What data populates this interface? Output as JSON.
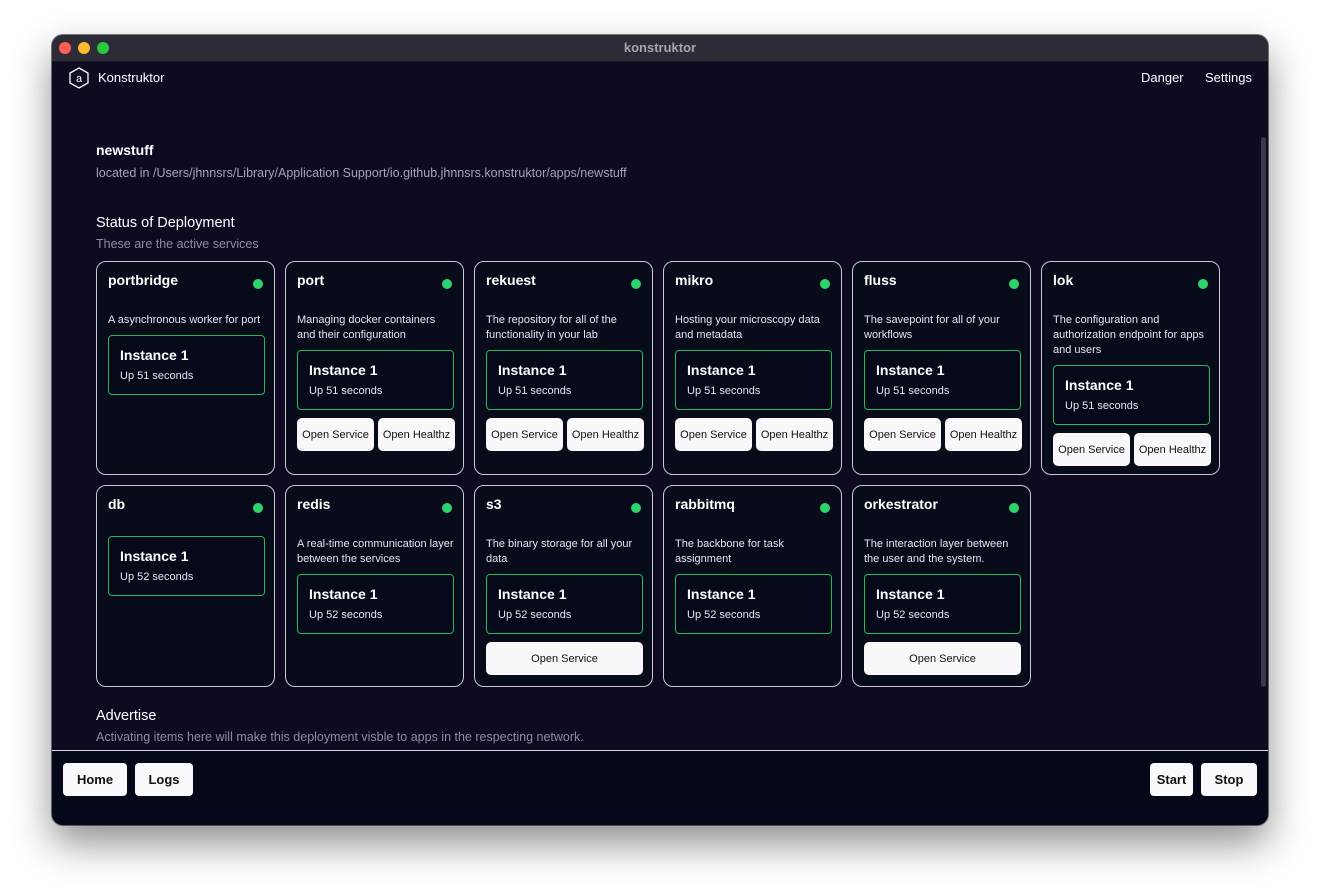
{
  "window": {
    "title": "konstruktor"
  },
  "navbar": {
    "brand": "Konstruktor",
    "logo_letter": "a",
    "danger": "Danger",
    "settings": "Settings"
  },
  "app": {
    "name": "newstuff",
    "path": "located in /Users/jhnnsrs/Library/Application Support/io.github.jhnnsrs.konstruktor/apps/newstuff"
  },
  "deployment": {
    "title": "Status of Deployment",
    "subtitle": "These are the active services"
  },
  "services": [
    {
      "name": "portbridge",
      "description": "A asynchronous worker for port",
      "instance": "Instance 1",
      "uptime": "Up 51 seconds"
    },
    {
      "name": "port",
      "description": "Managing docker containers and their configuration",
      "instance": "Instance 1",
      "uptime": "Up 51 seconds",
      "open_service": "Open Service",
      "open_healthz": "Open Healthz"
    },
    {
      "name": "rekuest",
      "description": "The repository for all of the functionality in your lab",
      "instance": "Instance 1",
      "uptime": "Up 51 seconds",
      "open_service": "Open Service",
      "open_healthz": "Open Healthz"
    },
    {
      "name": "mikro",
      "description": "Hosting your microscopy data and metadata",
      "instance": "Instance 1",
      "uptime": "Up 51 seconds",
      "open_service": "Open Service",
      "open_healthz": "Open Healthz"
    },
    {
      "name": "fluss",
      "description": "The savepoint for all of your workflows",
      "instance": "Instance 1",
      "uptime": "Up 51 seconds",
      "open_service": "Open Service",
      "open_healthz": "Open Healthz"
    },
    {
      "name": "lok",
      "description": "The configuration and authorization endpoint for apps and users",
      "instance": "Instance 1",
      "uptime": "Up 51 seconds",
      "open_service": "Open Service",
      "open_healthz": "Open Healthz"
    },
    {
      "name": "db",
      "description": "",
      "instance": "Instance 1",
      "uptime": "Up 52 seconds"
    },
    {
      "name": "redis",
      "description": "A real-time communication layer between the services",
      "instance": "Instance 1",
      "uptime": "Up 52 seconds"
    },
    {
      "name": "s3",
      "description": "The binary storage for all your data",
      "instance": "Instance 1",
      "uptime": "Up 52 seconds",
      "open_service": "Open Service"
    },
    {
      "name": "rabbitmq",
      "description": "The backbone for task assignment",
      "instance": "Instance 1",
      "uptime": "Up 52 seconds"
    },
    {
      "name": "orkestrator",
      "description": "The interaction layer between the user and the system.",
      "instance": "Instance 1",
      "uptime": "Up 52 seconds",
      "open_service": "Open Service"
    }
  ],
  "advertise": {
    "title": "Advertise",
    "subtitle": "Activating items here will make this deployment visble to apps in the respecting network."
  },
  "footer": {
    "home": "Home",
    "logs": "Logs",
    "start": "Start",
    "stop": "Stop"
  },
  "colors": {
    "background": "#0d0a22",
    "card": "#070b1a",
    "status_ok": "#2ed36b",
    "instance_border": "#23b65b"
  }
}
